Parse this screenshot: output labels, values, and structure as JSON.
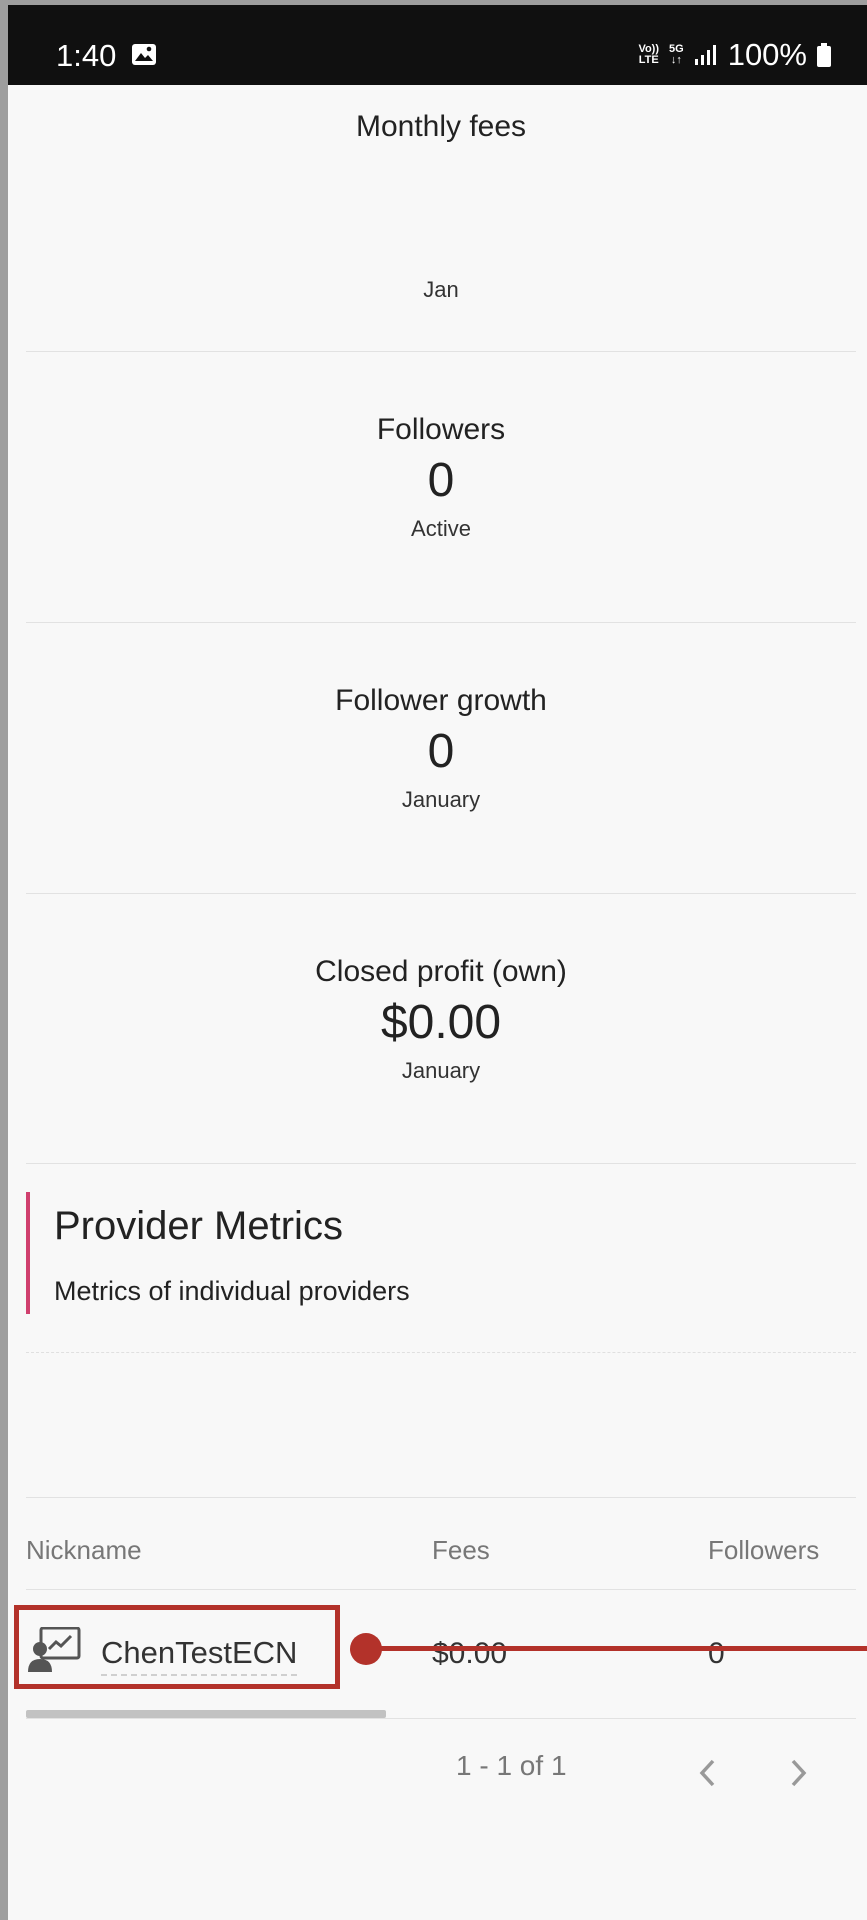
{
  "status_bar": {
    "time": "1:40",
    "network_volte_line1": "Vo))",
    "network_volte_line2": "LTE",
    "network_5g_line1": "5G",
    "network_5g_line2": "↓↑",
    "battery": "100%"
  },
  "stats": {
    "monthly_fees": {
      "title": "Monthly fees",
      "subtitle": "Jan"
    },
    "followers": {
      "title": "Followers",
      "value": "0",
      "subtitle": "Active"
    },
    "follower_growth": {
      "title": "Follower growth",
      "value": "0",
      "subtitle": "January"
    },
    "closed_profit": {
      "title": "Closed profit (own)",
      "value": "$0.00",
      "subtitle": "January"
    }
  },
  "provider_metrics": {
    "title": "Provider Metrics",
    "subtitle": "Metrics of individual providers"
  },
  "table": {
    "headers": {
      "nickname": "Nickname",
      "fees": "Fees",
      "followers": "Followers"
    },
    "rows": [
      {
        "nickname": "ChenTestECN",
        "fees": "$0.00",
        "followers": "0"
      }
    ]
  },
  "pagination": {
    "label": "1 - 1 of 1"
  },
  "colors": {
    "accent_bar": "#d0406e",
    "highlight": "#b3322a",
    "background": "#f8f8f8"
  }
}
